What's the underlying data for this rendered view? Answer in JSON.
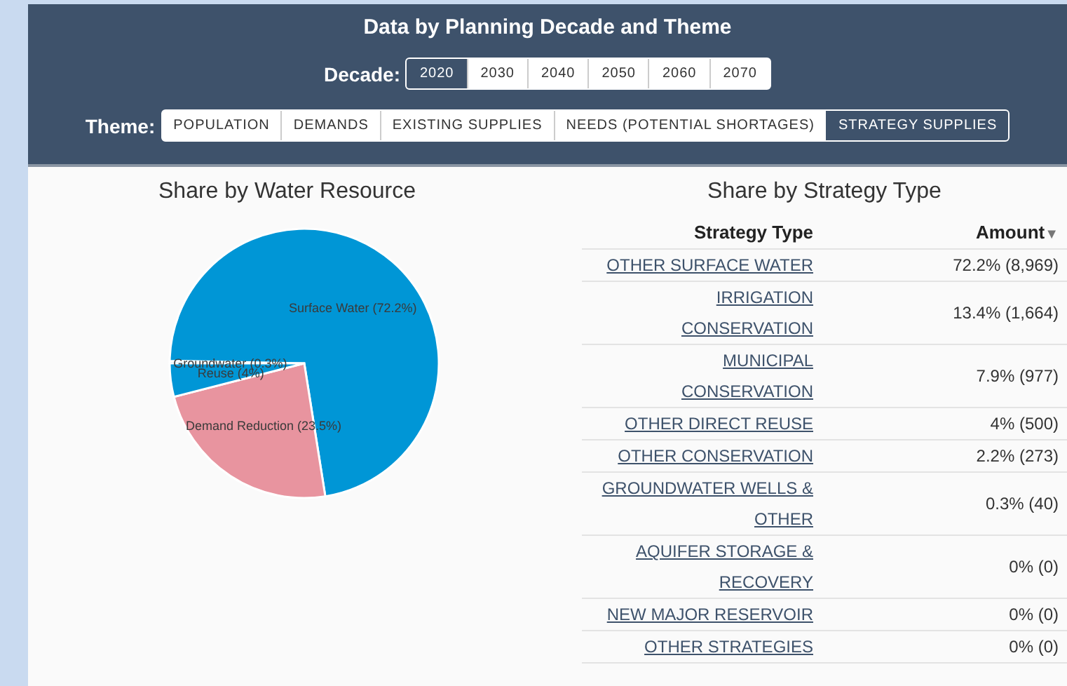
{
  "header": {
    "title": "Data by Planning Decade and Theme",
    "decade": {
      "label": "Decade:",
      "options": [
        {
          "label": "2020",
          "selected": true
        },
        {
          "label": "2030",
          "selected": false
        },
        {
          "label": "2040",
          "selected": false
        },
        {
          "label": "2050",
          "selected": false
        },
        {
          "label": "2060",
          "selected": false
        },
        {
          "label": "2070",
          "selected": false
        }
      ]
    },
    "theme": {
      "label": "Theme:",
      "options": [
        {
          "label": "POPULATION",
          "selected": false
        },
        {
          "label": "DEMANDS",
          "selected": false
        },
        {
          "label": "EXISTING SUPPLIES",
          "selected": false
        },
        {
          "label": "NEEDS (POTENTIAL SHORTAGES)",
          "selected": false
        },
        {
          "label": "STRATEGY SUPPLIES",
          "selected": true
        }
      ]
    }
  },
  "pie": {
    "chart_data": {
      "type": "pie",
      "title": "Share by Water Resource",
      "categories": [
        "Groundwater",
        "Surface Water",
        "Demand Reduction",
        "Reuse"
      ],
      "values": [
        0.3,
        72.2,
        23.5,
        4
      ],
      "colors": [
        "#0096d6",
        "#0096d6",
        "#e8949f",
        "#0096d6"
      ],
      "value_labels": [
        "(0.3%)",
        "(72.2%)",
        "(23.5%)",
        "(4%)"
      ]
    }
  },
  "table": {
    "title": "Share by Strategy Type",
    "columns": [
      "Strategy Type",
      "Amount"
    ],
    "sort_indicator": "▼",
    "rows": [
      {
        "type": "OTHER SURFACE WATER",
        "amount": "72.2% (8,969)"
      },
      {
        "type": "IRRIGATION CONSERVATION",
        "amount": "13.4% (1,664)"
      },
      {
        "type": "MUNICIPAL CONSERVATION",
        "amount": "7.9% (977)"
      },
      {
        "type": "OTHER DIRECT REUSE",
        "amount": "4% (500)"
      },
      {
        "type": "OTHER CONSERVATION",
        "amount": "2.2% (273)"
      },
      {
        "type": "GROUNDWATER WELLS & OTHER",
        "amount": "0.3% (40)"
      },
      {
        "type": "AQUIFER STORAGE & RECOVERY",
        "amount": "0% (0)"
      },
      {
        "type": "NEW MAJOR RESERVOIR",
        "amount": "0% (0)"
      },
      {
        "type": "OTHER STRATEGIES",
        "amount": "0% (0)"
      }
    ]
  }
}
